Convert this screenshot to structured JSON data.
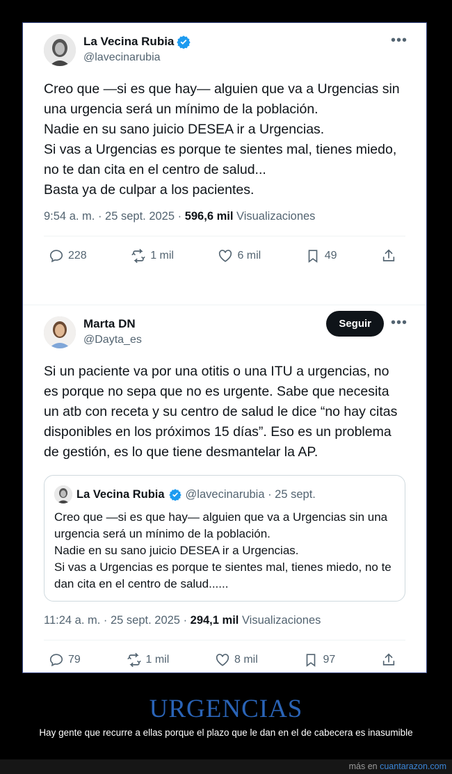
{
  "tweet1": {
    "name": "La Vecina Rubia",
    "handle": "@lavecinarubia",
    "more": "•••",
    "text": "Creo que —si es que hay— alguien que va a Urgencias sin una urgencia será un mínimo de la población.\nNadie en su sano juicio DESEA ir a Urgencias.\nSi vas a Urgencias es porque te sientes mal, tienes miedo, no te dan cita en el centro de salud...\nBasta ya de culpar a los pacientes.",
    "time": "9:54 a. m. · 25 sept. 2025 · ",
    "views": "596,6 mil",
    "views_label": " Visualizaciones",
    "replies": "228",
    "reposts": "1 mil",
    "likes": "6 mil",
    "bookmarks": "49"
  },
  "tweet2": {
    "name": "Marta DN",
    "handle": "@Dayta_es",
    "follow_label": "Seguir",
    "more": "•••",
    "text": "Si un paciente va por una otitis o una ITU a urgencias, no es porque no sepa que no es urgente. Sabe que necesita un atb con receta y su centro de salud le dice “no hay citas disponibles en los próximos 15 días”. Eso es un problema de gestión, es lo que tiene desmantelar la AP.",
    "quote": {
      "name": "La Vecina Rubia",
      "handle_date": "@lavecinarubia · 25 sept.",
      "text": "Creo que —si es que hay— alguien que va a Urgencias sin una urgencia será un mínimo de la población.\nNadie en su sano juicio DESEA ir a Urgencias.\nSi vas a Urgencias es porque te sientes mal, tienes miedo, no te dan cita en el centro de salud......"
    },
    "time": "11:24 a. m. · 25 sept. 2025 · ",
    "views": "294,1 mil",
    "views_label": " Visualizaciones",
    "replies": "79",
    "reposts": "1 mil",
    "likes": "8 mil",
    "bookmarks": "97"
  },
  "caption": {
    "title": "URGENCIAS",
    "subtitle": "Hay gente que recurre a ellas porque el plazo que le dan en el de cabecera es inasumible"
  },
  "footer": {
    "prefix": "más en ",
    "site": "cuantarazon.com"
  },
  "colors": {
    "verified": "#1d9bf0",
    "caption_title": "#2a64b7",
    "follow_button": "#0f1419"
  },
  "icons": [
    "reply-icon",
    "repost-icon",
    "like-icon",
    "bookmark-icon",
    "share-icon",
    "verified-badge-icon",
    "more-icon"
  ]
}
